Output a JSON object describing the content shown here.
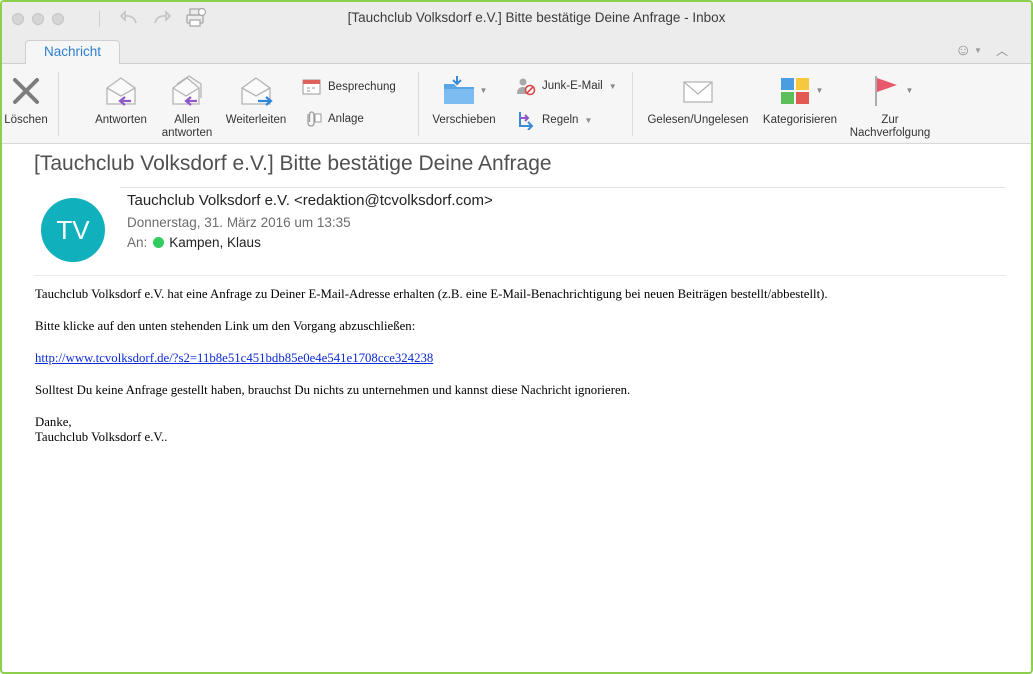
{
  "window": {
    "title": "[Tauchclub Volksdorf e.V.] Bitte bestätige Deine Anfrage - Inbox"
  },
  "tabs": {
    "active": "Nachricht"
  },
  "ribbon": {
    "delete": "Löschen",
    "reply": "Antworten",
    "reply_all_line1": "Allen",
    "reply_all_line2": "antworten",
    "forward": "Weiterleiten",
    "meeting": "Besprechung",
    "attachment": "Anlage",
    "move": "Verschieben",
    "junk": "Junk-E-Mail",
    "rules": "Regeln",
    "read_unread": "Gelesen/Ungelesen",
    "categorize": "Kategorisieren",
    "followup_line1": "Zur",
    "followup_line2": "Nachverfolgung"
  },
  "message": {
    "subject": "[Tauchclub Volksdorf e.V.] Bitte bestätige Deine Anfrage",
    "avatar_initials": "TV",
    "sender": "Tauchclub Volksdorf e.V. <redaktion@tcvolksdorf.com>",
    "date": "Donnerstag, 31. März 2016 um 13:35",
    "to_label": "An:",
    "recipient": "Kampen, Klaus",
    "body": {
      "p1": "Tauchclub Volksdorf e.V. hat eine Anfrage zu Deiner E-Mail-Adresse erhalten (z.B. eine E-Mail-Benachrichtigung bei neuen Beiträgen bestellt/abbestellt).",
      "p2": "Bitte klicke auf den unten stehenden Link um den Vorgang abzuschließen:",
      "link": "http://www.tcvolksdorf.de/?s2=11b8e51c451bdb85e0e4e541e1708cce324238",
      "p3": "Solltest Du keine Anfrage gestellt haben, brauchst Du nichts zu unternehmen und kannst diese Nachricht ignorieren.",
      "closing1": "Danke,",
      "closing2": "Tauchclub Volksdorf e.V.."
    }
  },
  "colors": {
    "accent": "#2d7fd0",
    "avatar": "#11b0bd",
    "presence": "#2fcd5f",
    "link": "#0b2bd9",
    "window_border": "#8ccf4d"
  },
  "icons": {
    "close": "close-icon",
    "minimize": "minimize-icon",
    "zoom": "zoom-icon",
    "undo": "undo-icon",
    "redo": "redo-icon",
    "print": "print-icon",
    "smiley": "feedback-smiley-icon",
    "collapse": "chevron-up-icon"
  }
}
